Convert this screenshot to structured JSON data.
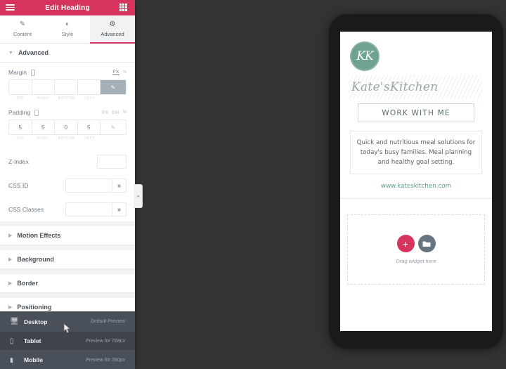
{
  "panel": {
    "header": {
      "title": "Edit Heading",
      "menu_icon": "hamburger-icon",
      "apps_icon": "grid-apps-icon"
    },
    "tabs": [
      {
        "label": "Content",
        "icon": "pencil-icon",
        "active": false
      },
      {
        "label": "Style",
        "icon": "contrast-icon",
        "active": false
      },
      {
        "label": "Advanced",
        "icon": "gear-icon",
        "active": true
      }
    ],
    "advanced_section": {
      "title": "Advanced",
      "expanded": true
    },
    "margin": {
      "label": "Margin",
      "units": [
        "PX",
        "%"
      ],
      "active_unit": "PX",
      "values": {
        "top": "",
        "right": "",
        "bottom": "",
        "left": ""
      },
      "sub_labels": [
        "TOP",
        "RIGHT",
        "BOTTOM",
        "LEFT"
      ],
      "linked": true
    },
    "padding": {
      "label": "Padding",
      "units": [
        "PX",
        "EM",
        "%"
      ],
      "active_unit": "PX",
      "values": {
        "top": "5",
        "right": "5",
        "bottom": "0",
        "left": "5"
      },
      "sub_labels": [
        "TOP",
        "RIGHT",
        "BOTTOM",
        "LEFT"
      ],
      "linked": false
    },
    "fields": [
      {
        "label": "Z-Index",
        "value": "",
        "has_button": false
      },
      {
        "label": "CSS ID",
        "value": "",
        "has_button": true,
        "button_icon": "dynamic-tags-icon"
      },
      {
        "label": "CSS Classes",
        "value": "",
        "has_button": true,
        "button_icon": "dynamic-tags-icon"
      }
    ],
    "sections": [
      {
        "label": "Motion Effects"
      },
      {
        "label": "Background"
      },
      {
        "label": "Border"
      },
      {
        "label": "Positioning"
      }
    ],
    "collapse_handle": "collapse-panel-handle"
  },
  "device_menu": [
    {
      "name": "Desktop",
      "note": "Default Preview",
      "icon": "monitor-icon",
      "highlighted": true
    },
    {
      "name": "Tablet",
      "note": "Preview for 768px",
      "icon": "tablet-icon",
      "highlighted": false
    },
    {
      "name": "Mobile",
      "note": "Preview for 360px",
      "icon": "mobile-icon",
      "highlighted": true
    }
  ],
  "preview": {
    "logo_text": "KK",
    "brand_name": "Kate'sKitchen",
    "cta_label": "WORK WITH ME",
    "blurb": "Quick and nutritious meal solutions for today's busy families. Meal planning and healthy goal setting.",
    "url": "www.kateskitchen.com",
    "dropzone": {
      "text": "Drag widget here",
      "add_icon": "plus-circle-icon",
      "template_icon": "folder-icon"
    }
  },
  "colors": {
    "accent": "#d6335d",
    "panel_bg": "#ffffff",
    "canvas_bg": "#333333",
    "brand_green": "#6fa292",
    "device_menu_bg": "#3f444b"
  }
}
